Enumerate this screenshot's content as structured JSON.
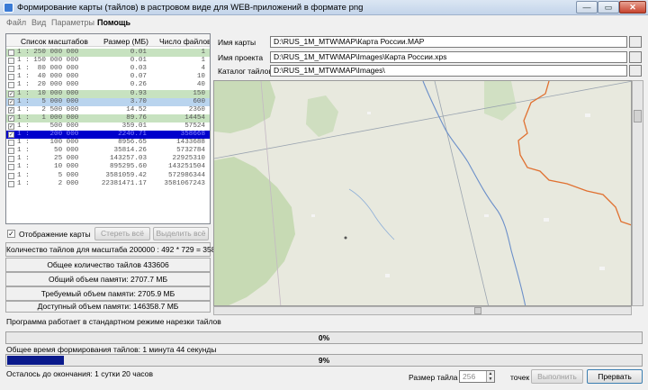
{
  "window": {
    "title": "Формирование карты (тайлов) в растровом виде для WEB-приложений в формате png",
    "min_glyph": "—",
    "max_glyph": "▭",
    "close_glyph": "✕"
  },
  "menu": [
    "Файл",
    "Вид",
    "Параметры",
    "Помощь"
  ],
  "scale_table": {
    "headers": [
      "Список масштабов",
      "Размер (МБ)",
      "Число файлов"
    ],
    "rows": [
      {
        "checked": false,
        "scale": "1 : 250 000 000",
        "size": "0.01",
        "files": "1",
        "style": "green"
      },
      {
        "checked": false,
        "scale": "1 : 150 000 000",
        "size": "0.01",
        "files": "1",
        "style": ""
      },
      {
        "checked": false,
        "scale": "1 :  80 000 000",
        "size": "0.03",
        "files": "4",
        "style": ""
      },
      {
        "checked": false,
        "scale": "1 :  40 000 000",
        "size": "0.07",
        "files": "10",
        "style": ""
      },
      {
        "checked": false,
        "scale": "1 :  20 000 000",
        "size": "0.26",
        "files": "40",
        "style": ""
      },
      {
        "checked": true,
        "scale": "1 :  10 000 000",
        "size": "0.93",
        "files": "150",
        "style": "green"
      },
      {
        "checked": true,
        "scale": "1 :   5 000 000",
        "size": "3.70",
        "files": "600",
        "style": "blue"
      },
      {
        "checked": true,
        "scale": "1 :   2 500 000",
        "size": "14.52",
        "files": "2360",
        "style": ""
      },
      {
        "checked": true,
        "scale": "1 :   1 000 000",
        "size": "89.76",
        "files": "14454",
        "style": "green"
      },
      {
        "checked": true,
        "scale": "1 :     500 000",
        "size": "359.01",
        "files": "57524",
        "style": ""
      },
      {
        "checked": true,
        "scale": "1 :     200 000",
        "size": "2240.71",
        "files": "358668",
        "style": "sel"
      },
      {
        "checked": false,
        "scale": "1 :     100 000",
        "size": "8956.65",
        "files": "1433688",
        "style": ""
      },
      {
        "checked": false,
        "scale": "1 :      50 000",
        "size": "35814.26",
        "files": "5732784",
        "style": ""
      },
      {
        "checked": false,
        "scale": "1 :      25 000",
        "size": "143257.03",
        "files": "22925310",
        "style": ""
      },
      {
        "checked": false,
        "scale": "1 :      10 000",
        "size": "895295.60",
        "files": "143251504",
        "style": ""
      },
      {
        "checked": false,
        "scale": "1 :       5 000",
        "size": "3581059.42",
        "files": "572986344",
        "style": ""
      },
      {
        "checked": false,
        "scale": "1 :       2 000",
        "size": "22381471.17",
        "files": "3581067243",
        "style": ""
      }
    ]
  },
  "controls": {
    "show_map_label": "Отображение карты",
    "show_map_checked": true,
    "clear_all": "Стереть всё",
    "select_all": "Выделить всё"
  },
  "info": {
    "tiles_for_scale": "Количество тайлов для масштаба 200000 : 492 * 729 = 358668",
    "total_tiles": "Общее количество тайлов 433606",
    "total_memory": "Общий объем памяти: 2707.7 МБ",
    "required_memory": "Требуемый объем памяти: 2705.9 МБ",
    "available_memory": "Доступный объем памяти: 146358.7 МБ"
  },
  "fields": {
    "map_name_label": "Имя карты",
    "map_name_value": "D:\\RUS_1M_MTW\\MAP\\Карта России.MAP",
    "project_name_label": "Имя проекта",
    "project_name_value": "D:\\RUS_1M_MTW\\MAP\\Images\\Карта России.xps",
    "tiles_dir_label": "Каталог тайлов",
    "tiles_dir_value": "D:\\RUS_1M_MTW\\MAP\\Images\\"
  },
  "status": {
    "mode_text": "Программа работает в стандартном режиме нарезки тайлов",
    "progress1_pct": 0,
    "progress1_text": "0%",
    "total_time": "Общее время формирования тайлов:  1 минута 44 секунды",
    "progress2_pct": 9,
    "progress2_text": "9%",
    "remaining": "Осталось до окончания:  1 сутки 20 часов"
  },
  "bottom": {
    "tile_size_label": "Размер тайла",
    "tile_size_value": "256",
    "units": "точек",
    "run": "Выполнить",
    "stop": "Прервать"
  },
  "colors": {
    "green_row": "#c7e2c0",
    "blue_row": "#b9d4ee",
    "selected_row": "#0000cc",
    "progress_fill": "#0a1a8c",
    "map_bg": "#e8e9de",
    "river": "#6b8fc9",
    "border_orange": "#e07030"
  }
}
